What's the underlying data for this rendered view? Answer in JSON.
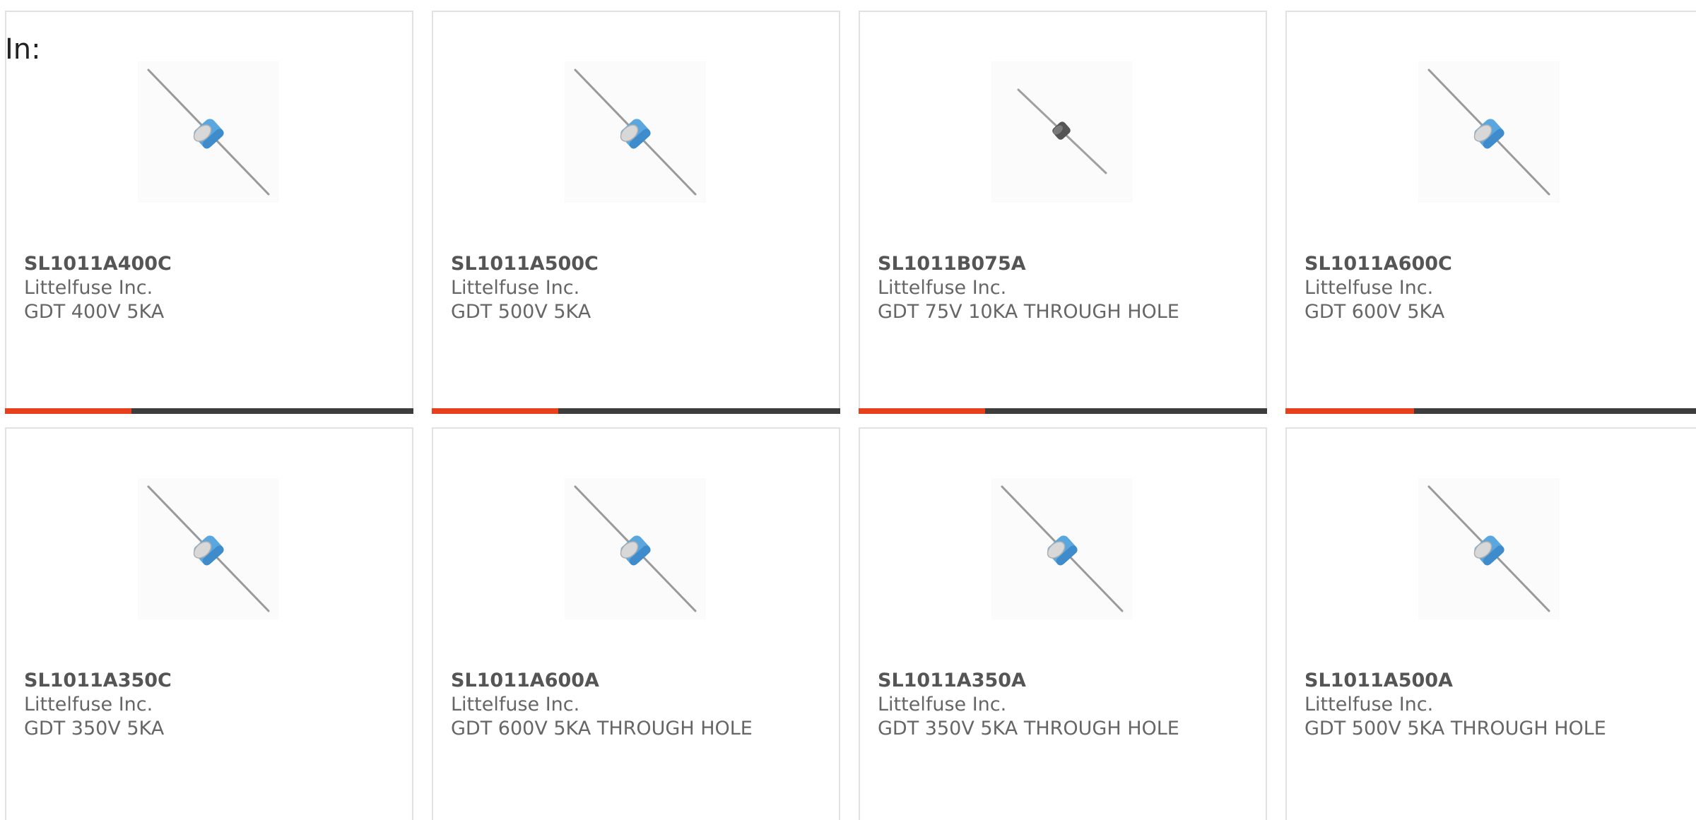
{
  "filter_label": "In:",
  "colors": {
    "accent": "#e8401c",
    "track": "#3d3d3d",
    "card_border": "#e2e2e2",
    "gdt_blue": "#5aa7e0",
    "gdt_dark": "#555555"
  },
  "products": [
    {
      "part_number": "SL1011A400C",
      "manufacturer": "Littelfuse Inc.",
      "description": "GDT 400V 5KA",
      "image_icon": "gdt-blue-icon",
      "progress": 0.31
    },
    {
      "part_number": "SL1011A500C",
      "manufacturer": "Littelfuse Inc.",
      "description": "GDT 500V 5KA",
      "image_icon": "gdt-blue-icon",
      "progress": 0.31
    },
    {
      "part_number": "SL1011B075A",
      "manufacturer": "Littelfuse Inc.",
      "description": "GDT 75V 10KA THROUGH HOLE",
      "image_icon": "gdt-dark-icon",
      "progress": 0.31
    },
    {
      "part_number": "SL1011A600C",
      "manufacturer": "Littelfuse Inc.",
      "description": "GDT 600V 5KA",
      "image_icon": "gdt-blue-icon",
      "progress": 0.31
    },
    {
      "part_number": "SL1011A350C",
      "manufacturer": "Littelfuse Inc.",
      "description": "GDT 350V 5KA",
      "image_icon": "gdt-blue-icon"
    },
    {
      "part_number": "SL1011A600A",
      "manufacturer": "Littelfuse Inc.",
      "description": "GDT 600V 5KA THROUGH HOLE",
      "image_icon": "gdt-blue-icon"
    },
    {
      "part_number": "SL1011A350A",
      "manufacturer": "Littelfuse Inc.",
      "description": "GDT 350V 5KA THROUGH HOLE",
      "image_icon": "gdt-blue-icon"
    },
    {
      "part_number": "SL1011A500A",
      "manufacturer": "Littelfuse Inc.",
      "description": "GDT 500V 5KA THROUGH HOLE",
      "image_icon": "gdt-blue-icon"
    }
  ]
}
